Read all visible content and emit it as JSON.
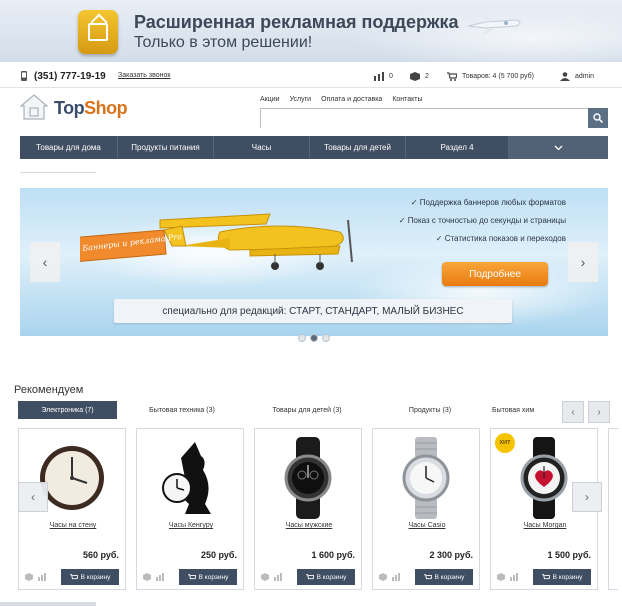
{
  "promo": {
    "title": "Расширенная рекламная поддержка",
    "subtitle": "Только в этом решении!"
  },
  "utilbar": {
    "phone": "(351) 777-19-19",
    "callback": "Заказать звонок",
    "compare_count": "0",
    "favorites_count": "2",
    "cart_text": "Товаров: 4 (5 700 руб)",
    "user": "admin"
  },
  "logo": {
    "top": "Top",
    "shop": "Shop"
  },
  "toplinks": [
    "Акции",
    "Услуги",
    "Оплата и доставка",
    "Контакты"
  ],
  "search": {
    "value": "",
    "placeholder": ""
  },
  "nav": [
    "Товары для дома",
    "Продукты питания",
    "Часы",
    "Товары для детей",
    "Раздел 4"
  ],
  "slider": {
    "banner_flag": "Баннеры и реклама Pro",
    "features": [
      "Поддержка баннеров любых форматов",
      "Показ с точностью до секунды и страницы",
      "Статистика показов и переходов"
    ],
    "more_button": "Подробнее",
    "ribbon": "специально для редакций: СТАРТ, СТАНДАРТ, МАЛЫЙ БИЗНЕС"
  },
  "recommend": {
    "title": "Рекомендуем",
    "tabs": [
      "Электроника (7)",
      "Бытовая техника (3)",
      "Товары для детей (3)",
      "Продукты (3)",
      "Бытовая хим"
    ],
    "cart_label": "В корзину",
    "hit_label": "ХИТ",
    "products": [
      {
        "name": "Часы на стену",
        "price": "560 руб.",
        "icon": "wall-clock-icon"
      },
      {
        "name": "Часы Кенгуру",
        "price": "250 руб.",
        "icon": "kangaroo-clock-icon"
      },
      {
        "name": "Часы мужские",
        "price": "1 600 руб.",
        "icon": "black-watch-icon"
      },
      {
        "name": "Часы Casio",
        "price": "2 300 руб.",
        "icon": "steel-watch-icon"
      },
      {
        "name": "Часы Morgan",
        "price": "1 500 руб.",
        "icon": "heart-watch-icon"
      }
    ]
  },
  "colors": {
    "accent": "#3f4e62",
    "orange": "#e87b10",
    "hit": "#f5c400"
  }
}
